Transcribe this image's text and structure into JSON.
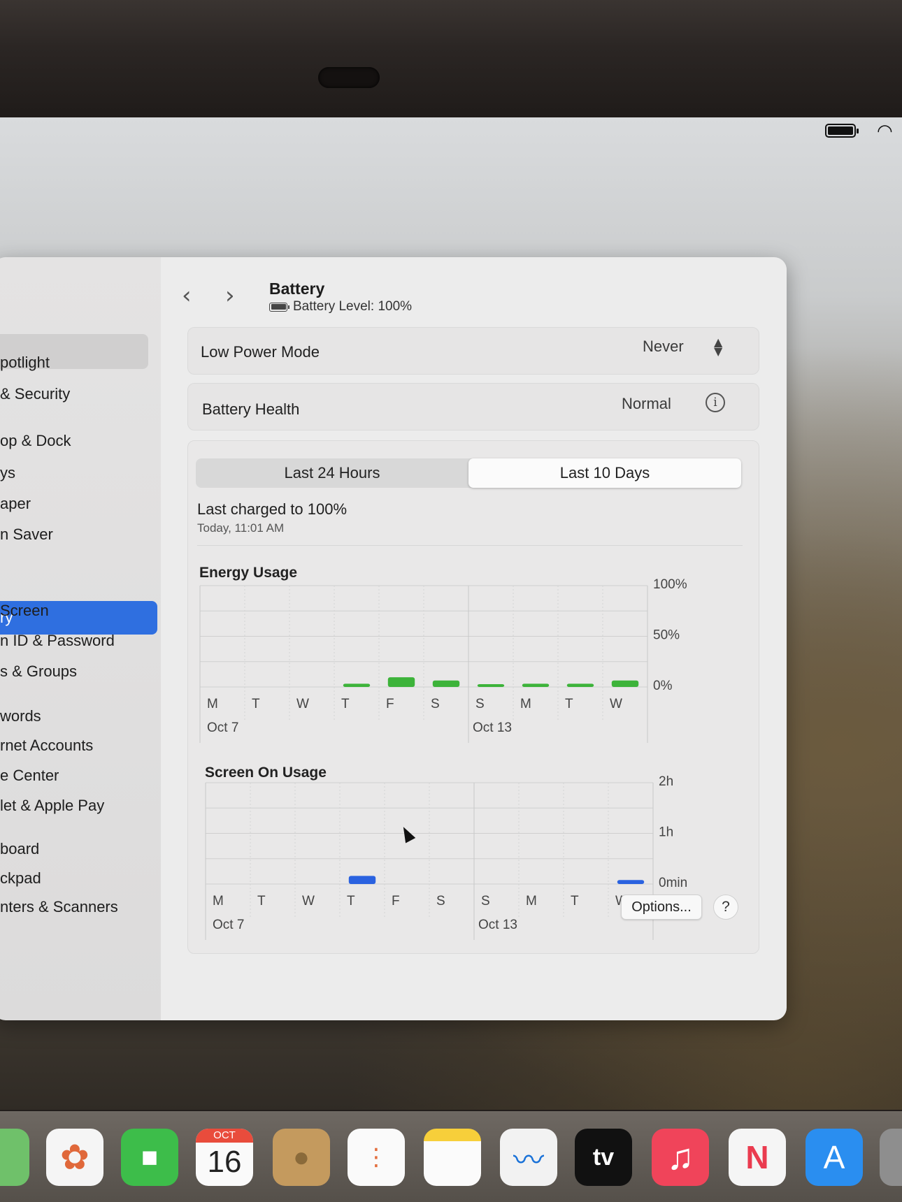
{
  "menubar": {
    "battery_icon": "battery-full-icon",
    "wifi_icon": "wifi-icon"
  },
  "sidebar": {
    "items": [
      {
        "label": "potlight"
      },
      {
        "label": "& Security"
      },
      {
        "label": "op & Dock"
      },
      {
        "label": "ys"
      },
      {
        "label": "aper"
      },
      {
        "label": "n Saver"
      },
      {
        "label": "ry",
        "selected": true
      },
      {
        "label": "Screen"
      },
      {
        "label": "n ID & Password"
      },
      {
        "label": "s & Groups"
      },
      {
        "label": "words"
      },
      {
        "label": "rnet Accounts"
      },
      {
        "label": "e Center"
      },
      {
        "label": "let & Apple Pay"
      },
      {
        "label": "board"
      },
      {
        "label": "ckpad"
      },
      {
        "label": "nters & Scanners"
      }
    ]
  },
  "header": {
    "back_icon": "chevron-left-icon",
    "forward_icon": "chevron-right-icon",
    "title": "Battery",
    "subtitle": "Battery Level: 100%"
  },
  "low_power": {
    "label": "Low Power Mode",
    "value": "Never"
  },
  "battery_health": {
    "label": "Battery Health",
    "value": "Normal"
  },
  "segmented": {
    "options": [
      "Last 24 Hours",
      "Last 10 Days"
    ],
    "selected": "Last 10 Days"
  },
  "last_charged": {
    "text": "Last charged to 100%",
    "time": "Today, 11:01 AM"
  },
  "charts": {
    "energy_title": "Energy Usage",
    "screen_title": "Screen On Usage"
  },
  "chart_data": [
    {
      "type": "bar",
      "title": "Energy Usage",
      "categories": [
        "M",
        "T",
        "W",
        "T",
        "F",
        "S",
        "S",
        "M",
        "T",
        "W"
      ],
      "date_labels": [
        "Oct 7",
        "Oct 13"
      ],
      "y_tick_labels": [
        "100%",
        "50%",
        "0%"
      ],
      "ylim": [
        0,
        100
      ],
      "unit": "%",
      "values": [
        0,
        0,
        0,
        2,
        6,
        4,
        1,
        2,
        2,
        4
      ],
      "color": "#3db33a",
      "grid": true
    },
    {
      "type": "bar",
      "title": "Screen On Usage",
      "categories": [
        "M",
        "T",
        "W",
        "T",
        "F",
        "S",
        "S",
        "M",
        "T",
        "W"
      ],
      "date_labels": [
        "Oct 7",
        "Oct 13"
      ],
      "y_tick_labels": [
        "2h",
        "1h",
        "0min"
      ],
      "ylim": [
        0,
        120
      ],
      "unit": "min",
      "values": [
        0,
        0,
        0,
        6,
        0,
        0,
        0,
        0,
        0,
        3
      ],
      "color": "#2a62e0",
      "grid": true
    }
  ],
  "footer": {
    "options_label": "Options...",
    "help_label": "?"
  },
  "dock": {
    "apps": [
      {
        "name": "maps"
      },
      {
        "name": "photos"
      },
      {
        "name": "facetime"
      },
      {
        "name": "calendar",
        "month": "OCT",
        "day": "16"
      },
      {
        "name": "contacts"
      },
      {
        "name": "reminders"
      },
      {
        "name": "notes"
      },
      {
        "name": "freeform"
      },
      {
        "name": "tv",
        "label": "tv"
      },
      {
        "name": "music"
      },
      {
        "name": "news"
      },
      {
        "name": "app-store"
      },
      {
        "name": "settings"
      }
    ]
  }
}
